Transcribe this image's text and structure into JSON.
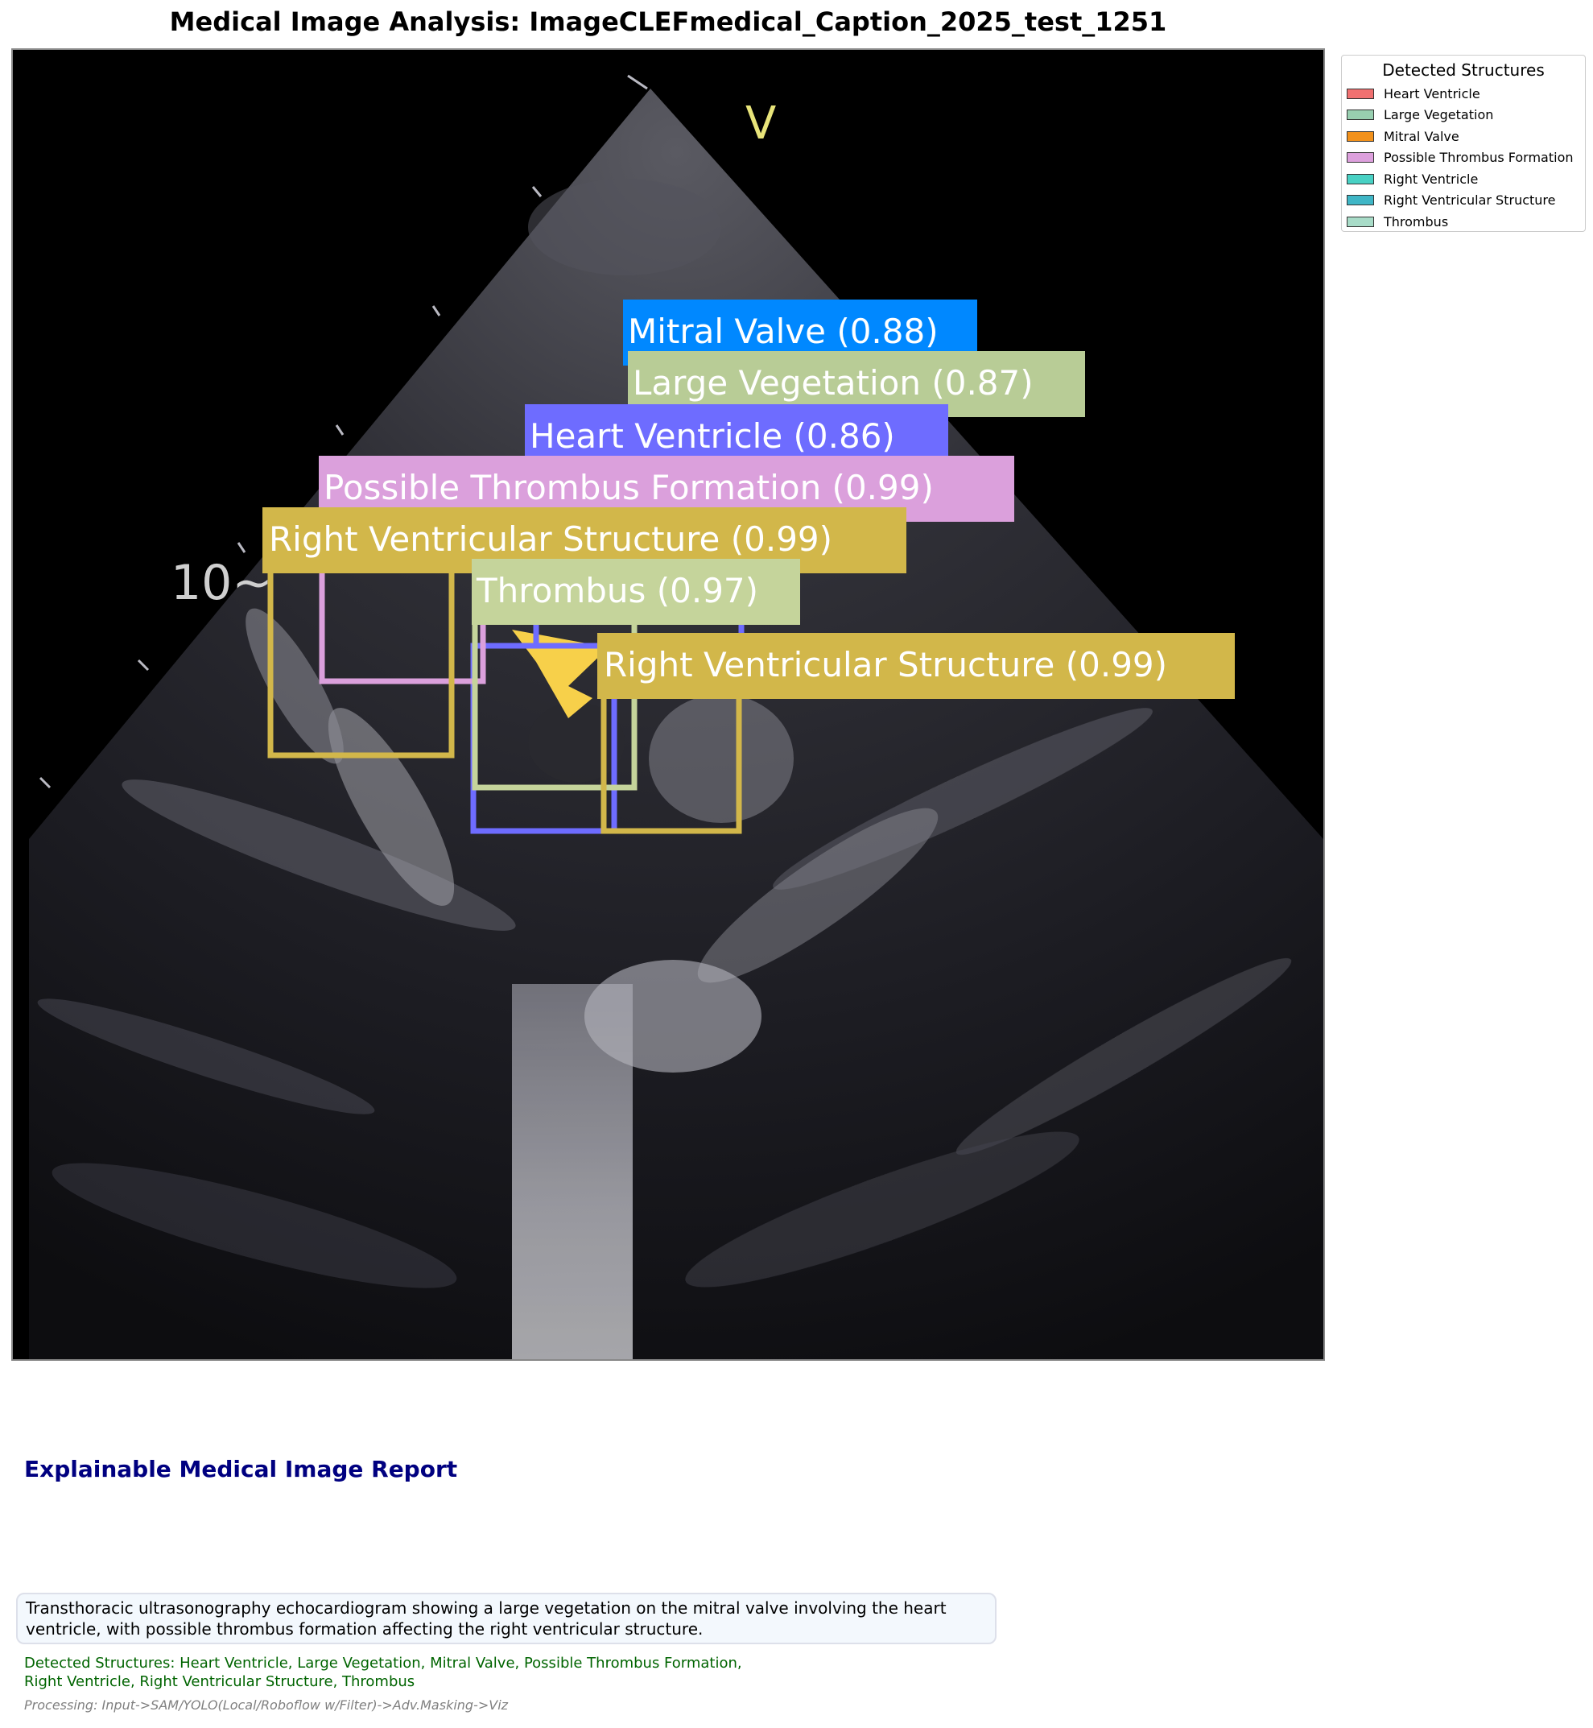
{
  "title": "Medical Image Analysis: ImageCLEFmedical_Caption_2025_test_1251",
  "ultrasound": {
    "marker_v": "V",
    "depth_marker": "10~"
  },
  "detections": [
    {
      "label": "Mitral Valve (0.88)",
      "color": "#0088ff"
    },
    {
      "label": "Large Vegetation (0.87)",
      "color": "#b8cc96"
    },
    {
      "label": "Heart Ventricle (0.86)",
      "color": "#6e6cff"
    },
    {
      "label": "Possible Thrombus Formation (0.99)",
      "color": "#dba0dc"
    },
    {
      "label": "Right Ventricular Structure (0.99)",
      "color": "#d2b74a"
    },
    {
      "label": "Thrombus (0.97)",
      "color": "#c5d49b"
    },
    {
      "label": "Right Ventricular Structure (0.99)",
      "color": "#d2b74a"
    }
  ],
  "legend": {
    "title": "Detected Structures",
    "items": [
      {
        "label": "Heart Ventricle",
        "color": "#f07070"
      },
      {
        "label": "Large Vegetation",
        "color": "#98cfb0"
      },
      {
        "label": "Mitral Valve",
        "color": "#f2911b"
      },
      {
        "label": "Possible Thrombus Formation",
        "color": "#dda0dd"
      },
      {
        "label": "Right Ventricle",
        "color": "#48d1c4"
      },
      {
        "label": "Right Ventricular Structure",
        "color": "#3fb6c6"
      },
      {
        "label": "Thrombus",
        "color": "#a8dcc8"
      }
    ]
  },
  "report": {
    "title": "Explainable Medical Image Report",
    "caption_line1": "Transthoracic ultrasonography echocardiogram showing a large vegetation on the mitral valve involving the heart",
    "caption_line2": "ventricle, with possible thrombus formation affecting the right ventricular structure.",
    "detected_line1": "Detected Structures: Heart Ventricle, Large Vegetation, Mitral Valve, Possible Thrombus Formation,",
    "detected_line2": "Right Ventricle, Right Ventricular Structure, Thrombus",
    "processing": "Processing: Input->SAM/YOLO(Local/Roboflow w/Filter)->Adv.Masking->Viz"
  }
}
